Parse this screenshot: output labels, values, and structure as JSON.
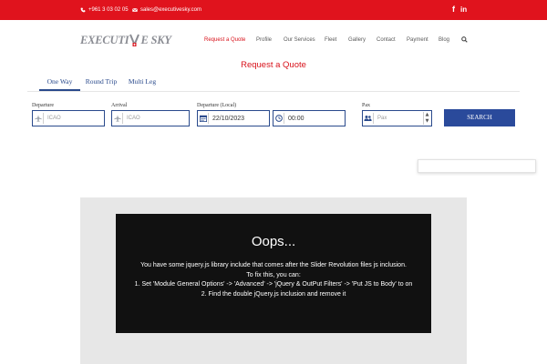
{
  "topbar": {
    "phone": "+961 3 03 02 05",
    "email": "sales@executivesky.com",
    "social": {
      "facebook": "f",
      "linkedin": "in"
    },
    "colors": {
      "background": "#e0131d"
    }
  },
  "logo": {
    "left_text": "EXECUTI",
    "right_text": "E SKY"
  },
  "nav": {
    "items": [
      "Request a Quote",
      "Profile",
      "Our Services",
      "Fleet",
      "Gallery",
      "Contact",
      "Payment",
      "Blog"
    ],
    "active_index": 0,
    "search_icon": "search-icon"
  },
  "quote": {
    "title": "Request a Quote"
  },
  "tabs": [
    "One Way",
    "Round Trip",
    "Multi Leg"
  ],
  "form": {
    "departure": {
      "label": "Departure",
      "placeholder": "ICAO",
      "icon": "plane-icon"
    },
    "arrival": {
      "label": "Arrival",
      "placeholder": "ICAO",
      "icon": "plane-icon"
    },
    "departure_local": {
      "label": "Departure (Local)",
      "date": "22/10/2023",
      "time": "00:00",
      "date_icon": "calendar-icon",
      "time_icon": "clock-icon"
    },
    "pax": {
      "label": "Pax",
      "placeholder": "Pax",
      "icon": "users-icon"
    },
    "search_label": "SEARCH",
    "colors": {
      "accent": "#2a4a9b"
    }
  },
  "slider_error": {
    "title": "Oops...",
    "lines": [
      "You have some jquery.js library include that comes after the Slider Revolution files js inclusion.",
      "To fix this, you can:",
      "1. Set 'Module General Options' -> 'Advanced' -> 'jQuery & OutPut Filters' -> 'Put JS to Body' to on",
      "2. Find the double jQuery.js inclusion and remove it"
    ]
  }
}
